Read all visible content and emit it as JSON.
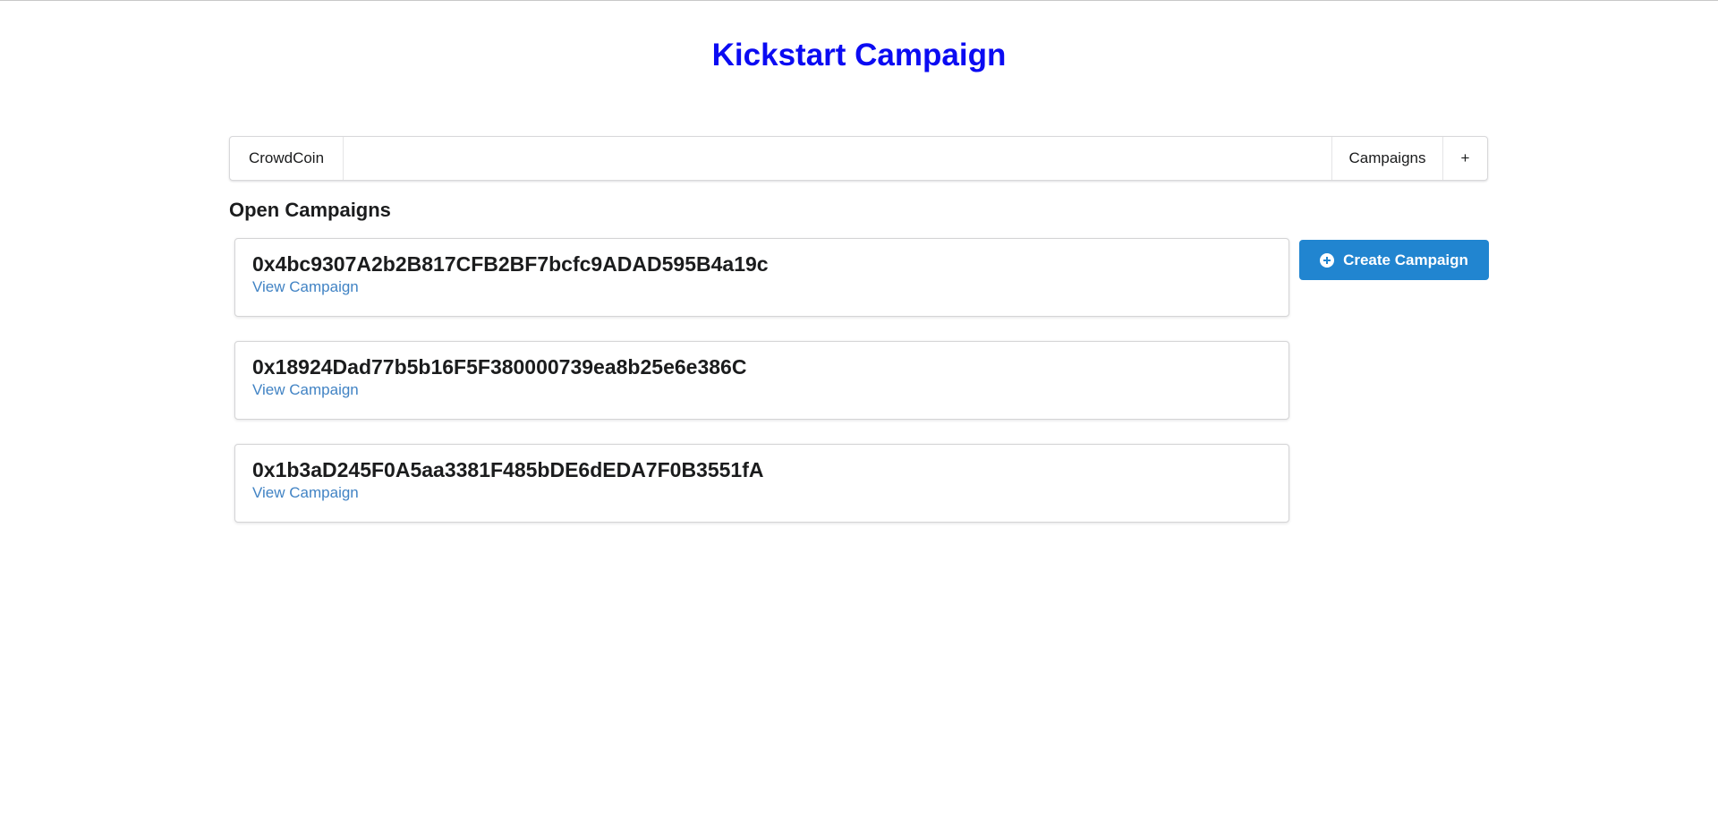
{
  "page": {
    "title": "Kickstart Campaign",
    "title_color": "#0b0bf2"
  },
  "menu": {
    "brand": "CrowdCoin",
    "campaigns": "Campaigns",
    "add": "+"
  },
  "section": {
    "title": "Open Campaigns"
  },
  "campaigns": [
    {
      "address": "0x4bc9307A2b2B817CFB2BF7bcfc9ADAD595B4a19c",
      "link_label": "View Campaign"
    },
    {
      "address": "0x18924Dad77b5b16F5F380000739ea8b25e6e386C",
      "link_label": "View Campaign"
    },
    {
      "address": "0x1b3aD245F0A5aa3381F485bDE6dEDA7F0B3551fA",
      "link_label": "View Campaign"
    }
  ],
  "create_button": {
    "label": "Create Campaign",
    "icon": "plus-circle-icon",
    "color": "#2185d0"
  },
  "link_color": "#4183c4"
}
